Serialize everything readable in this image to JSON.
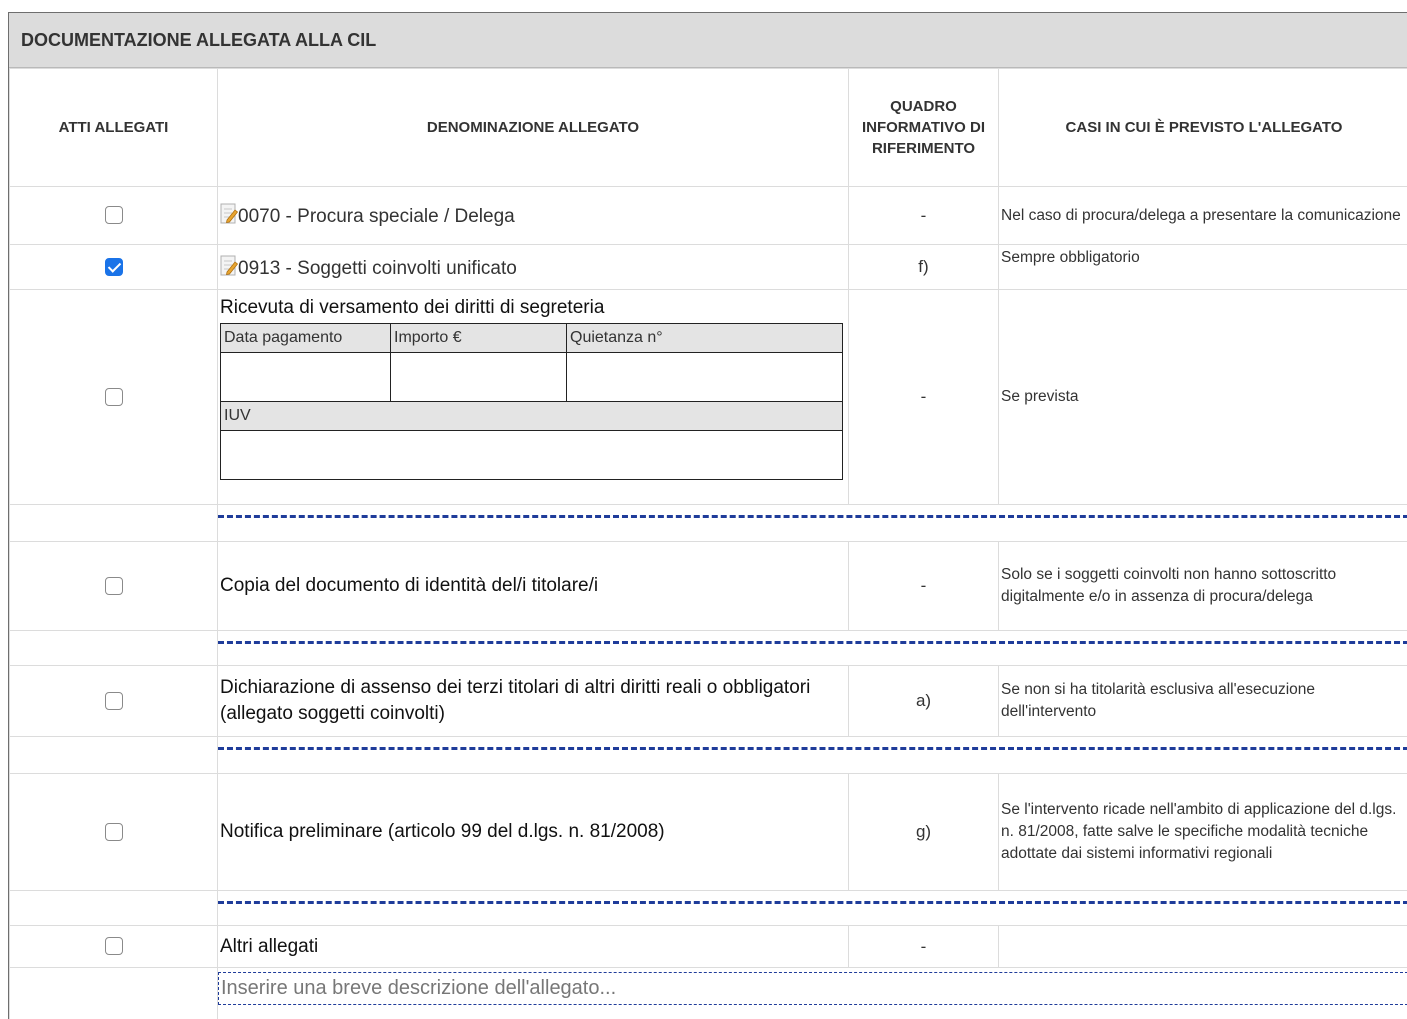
{
  "section": {
    "title": "DOCUMENTAZIONE ALLEGATA ALLA CIL"
  },
  "headers": {
    "atti": "ATTI ALLEGATI",
    "denominazione": "DENOMINAZIONE ALLEGATO",
    "quadro": "QUADRO INFORMATIVO DI RIFERIMENTO",
    "casi": "CASI IN CUI È PREVISTO L'ALLEGATO"
  },
  "rows": [
    {
      "checked": false,
      "icon": "edit-document-icon",
      "label": "0070 - Procura speciale / Delega",
      "quadro": "-",
      "casi": "Nel caso di procura/delega a presentare la comunicazione"
    },
    {
      "checked": true,
      "icon": "edit-document-icon",
      "label": "0913 - Soggetti coinvolti unificato",
      "quadro": "f)",
      "casi": "Sempre obbligatorio"
    },
    {
      "checked": false,
      "label": "Ricevuta di versamento dei diritti di segreteria",
      "quadro": "-",
      "casi": "Se prevista",
      "payment": {
        "data_pagamento_label": "Data pagamento",
        "importo_label": "Importo €",
        "quietanza_label": "Quietanza n°",
        "iuv_label": "IUV",
        "data_pagamento": "",
        "importo": "",
        "quietanza": "",
        "iuv": ""
      }
    },
    {
      "checked": false,
      "label": "Copia del documento di identità del/i titolare/i",
      "quadro": "-",
      "casi": "Solo se i soggetti coinvolti non hanno sottoscritto digitalmente e/o in assenza di procura/delega"
    },
    {
      "checked": false,
      "label": "Dichiarazione di assenso dei terzi titolari di altri diritti reali o obbligatori (allegato soggetti coinvolti)",
      "quadro": "a)",
      "casi": "Se non si ha titolarità esclusiva all'esecuzione dell'intervento"
    },
    {
      "checked": false,
      "label": "Notifica preliminare (articolo 99 del d.lgs. n. 81/2008)",
      "quadro": "g)",
      "casi": "Se l'intervento ricade nell'ambito di applicazione del d.lgs. n. 81/2008, fatte salve le specifiche modalità tecniche adottate dai sistemi informativi regionali"
    },
    {
      "checked": false,
      "label": "Altri allegati",
      "quadro": "-",
      "casi": ""
    }
  ],
  "altri": {
    "placeholder": "Inserire una breve descrizione dell'allegato...",
    "value": ""
  },
  "colors": {
    "accent": "#1a73e8",
    "dash": "#1f3c9a",
    "header_bg": "#dcdcdc"
  }
}
